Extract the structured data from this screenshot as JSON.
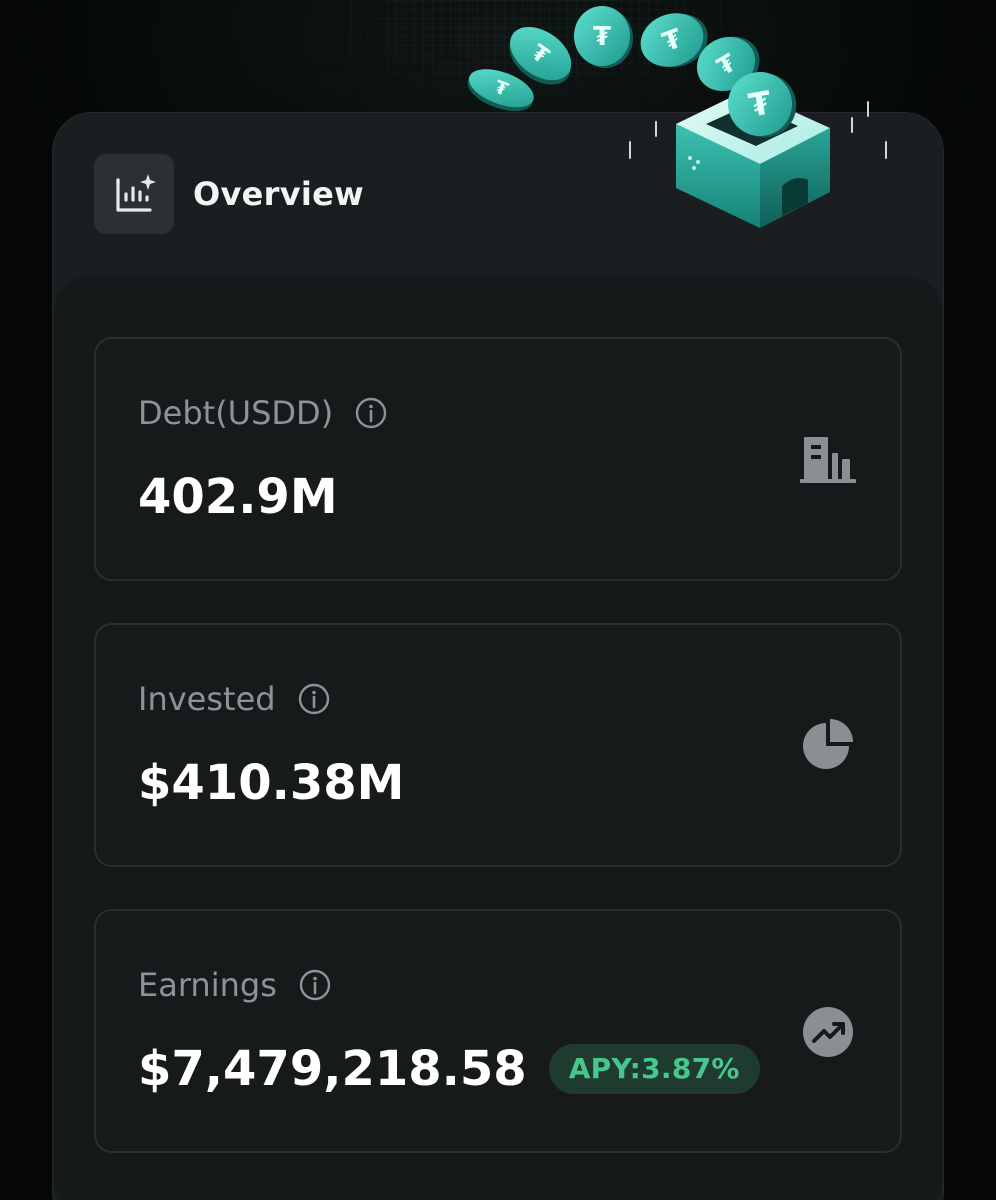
{
  "header": {
    "title": "Overview",
    "icon": "analytics-chart-icon"
  },
  "illustration": {
    "description_icon": "usdt-coins-into-box-illustration"
  },
  "cards": [
    {
      "label": "Debt(USDD)",
      "value": "402.9M",
      "icon": "building-icon"
    },
    {
      "label": "Invested",
      "value": "$410.38M",
      "icon": "pie-chart-icon"
    },
    {
      "label": "Earnings",
      "value": "$7,479,218.58",
      "badge": "APY:3.87%",
      "icon": "trending-up-icon"
    }
  ],
  "colors": {
    "background": "#050707",
    "panel": "#1b1e20",
    "card": "#171a1b",
    "accent_green": "#46c78c",
    "teal": "#2bb5a8"
  }
}
